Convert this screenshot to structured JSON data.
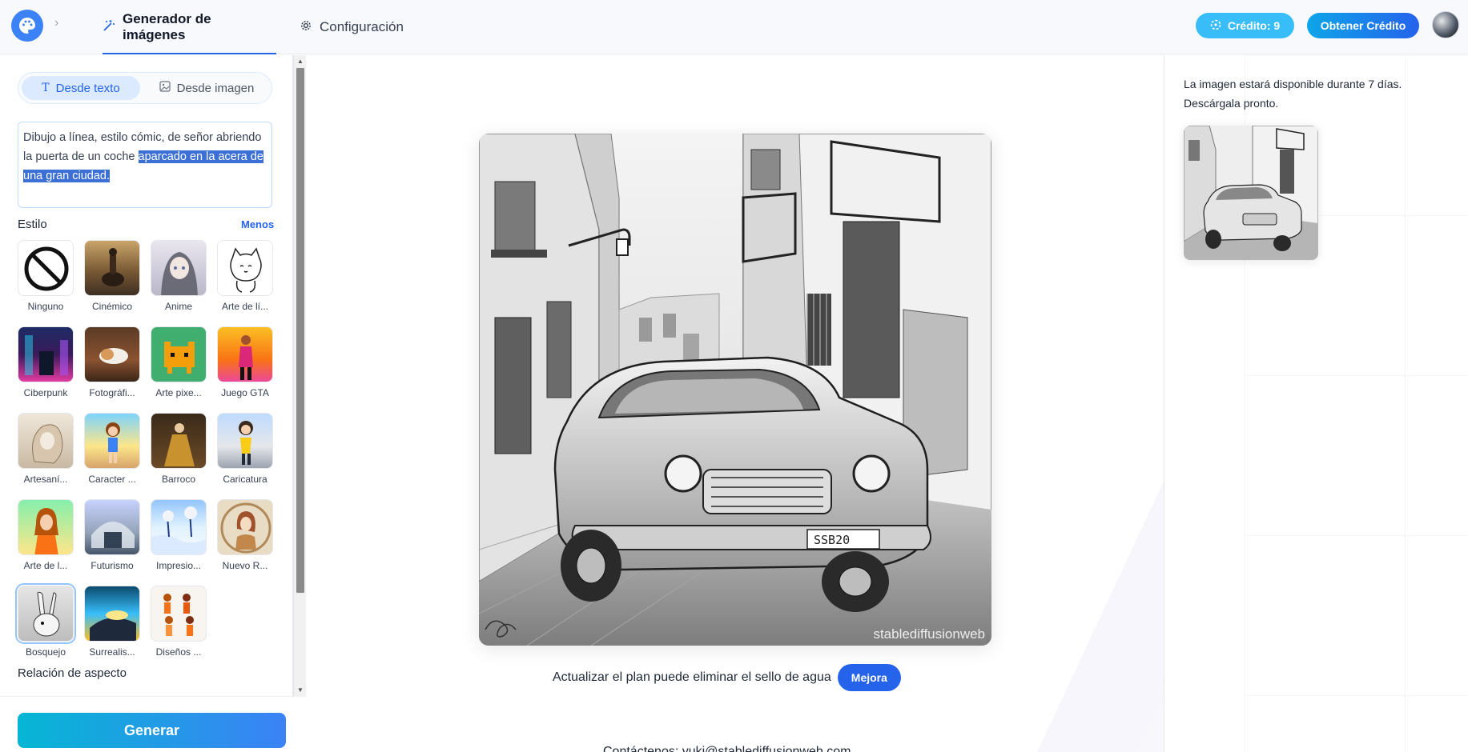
{
  "header": {
    "tabs": [
      {
        "label": "Generador de imágenes",
        "icon": "magic-wand-icon",
        "active": true
      },
      {
        "label": "Configuración",
        "icon": "gear-icon",
        "active": false
      }
    ],
    "credit_label": "Crédito: 9",
    "get_credit_label": "Obtener Crédito"
  },
  "sidebar": {
    "modes": [
      {
        "label": "Desde texto",
        "icon": "text-icon",
        "active": true
      },
      {
        "label": "Desde imagen",
        "icon": "image-icon",
        "active": false
      }
    ],
    "prompt": {
      "text_plain": "Dibujo a línea, estilo cómic, de señor abriendo la puerta de un coche ",
      "text_selected": "aparcado en la acera de una gran ciudad."
    },
    "style_label": "Estilo",
    "less_label": "Menos",
    "styles": [
      {
        "label": "Ninguno"
      },
      {
        "label": "Cinémico"
      },
      {
        "label": "Anime"
      },
      {
        "label": "Arte de lí..."
      },
      {
        "label": "Ciberpunk"
      },
      {
        "label": "Fotográfi..."
      },
      {
        "label": "Arte pixe..."
      },
      {
        "label": "Juego GTA"
      },
      {
        "label": "Artesaní..."
      },
      {
        "label": "Caracter ..."
      },
      {
        "label": "Barroco"
      },
      {
        "label": "Caricatura"
      },
      {
        "label": "Arte de l..."
      },
      {
        "label": "Futurismo"
      },
      {
        "label": "Impresio..."
      },
      {
        "label": "Nuevo R..."
      },
      {
        "label": "Bosquejo",
        "selected": true
      },
      {
        "label": "Surrealis..."
      },
      {
        "label": "Diseños ..."
      }
    ],
    "aspect_label": "Relación de aspecto",
    "generate_label": "Generar"
  },
  "main": {
    "watermark": "stablediffusionweb",
    "notice": "Actualizar el plan puede eliminar el sello de agua",
    "upgrade_label": "Mejora",
    "contact": "Contáctenos: yuki@stablediffusionweb.com"
  },
  "right": {
    "availability": "La imagen estará disponible durante 7 días. Descárgala pronto."
  },
  "colors": {
    "accent": "#2563eb",
    "credit_badge": "#38bdf8",
    "selection": "#3b6fd4"
  }
}
